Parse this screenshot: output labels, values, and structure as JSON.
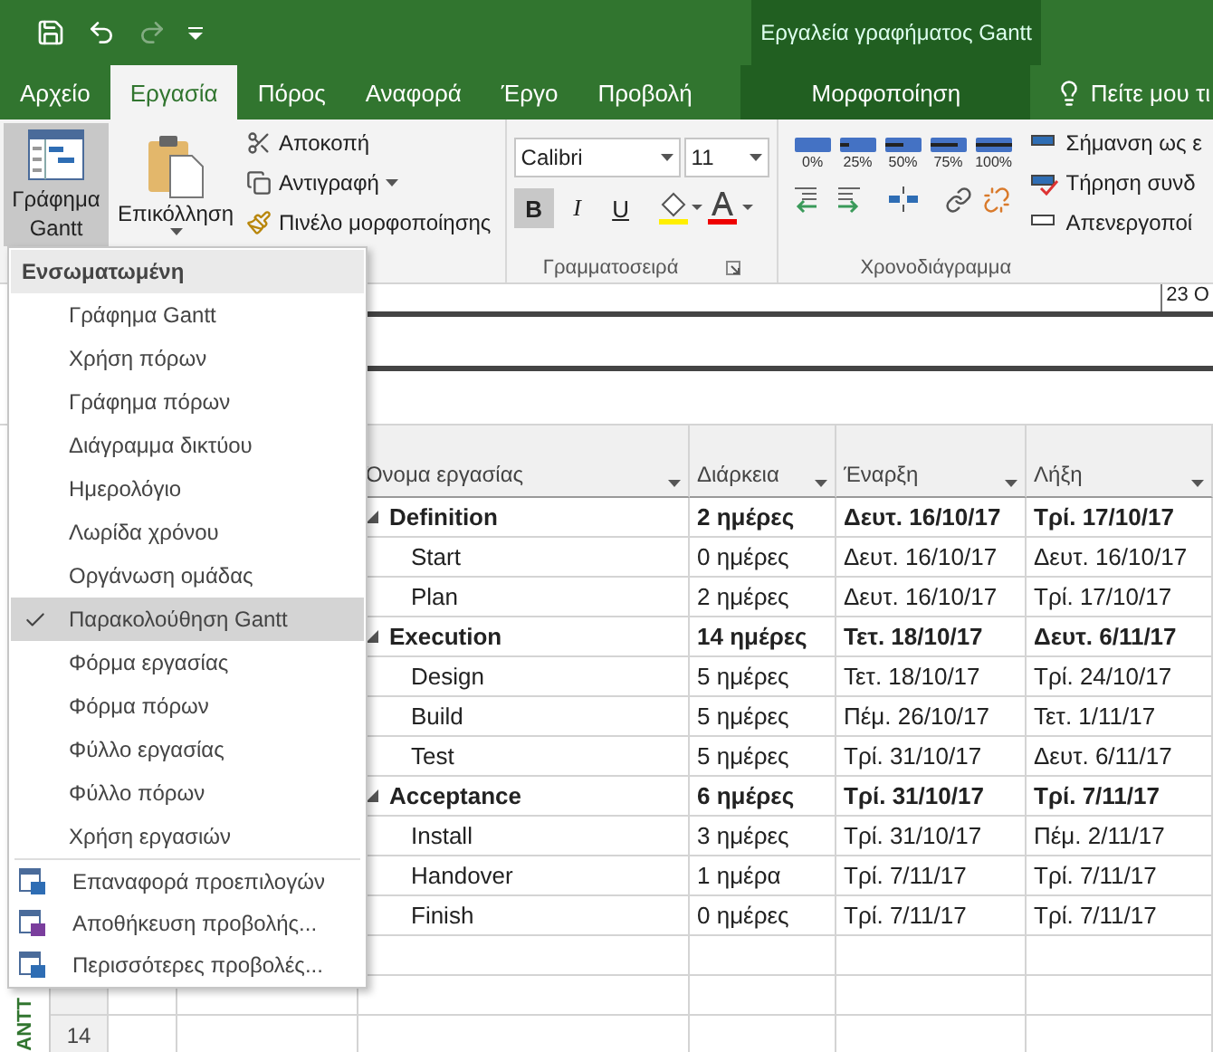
{
  "title_bar": {
    "context_title": "Εργαλεία γραφήματος Gantt",
    "redo_disabled": true
  },
  "tabs": [
    {
      "label": "Αρχείο",
      "selected": false
    },
    {
      "label": "Εργασία",
      "selected": true
    },
    {
      "label": "Πόρος",
      "selected": false
    },
    {
      "label": "Αναφορά",
      "selected": false
    },
    {
      "label": "Έργο",
      "selected": false
    },
    {
      "label": "Προβολή",
      "selected": false
    }
  ],
  "context_tab": {
    "label": "Μορφοποίηση",
    "selected": false
  },
  "tell_me": "Πείτε μου τι",
  "ribbon": {
    "view_button": {
      "label": "Γράφημα Gantt",
      "pressed": true
    },
    "paste": "Επικόλληση",
    "clipboard": [
      "Αποκοπή",
      "Αντιγραφή",
      "Πινέλο μορφοποίησης"
    ],
    "font": {
      "name": "Calibri",
      "size": "11",
      "format": [
        {
          "label": "B",
          "kind": "bold",
          "on": true
        },
        {
          "label": "I",
          "kind": "italic",
          "on": false
        },
        {
          "label": "U",
          "kind": "underline",
          "on": false
        }
      ],
      "label": "Γραμματοσειρά"
    },
    "progress": [
      "0%",
      "25%",
      "50%",
      "75%",
      "100%"
    ],
    "schedule_label": "Χρονοδιάγραμμα",
    "tasks_group": [
      "Σήμανση ως ε",
      "Τήρηση συνδ",
      "Απενεργοποί"
    ]
  },
  "timeline": {
    "date": "23 Ο"
  },
  "table": {
    "columns": [
      "Όνομα εργασίας",
      "Διάρκεια",
      "Έναρξη",
      "Λήξη"
    ],
    "rows": [
      {
        "name": "Definition",
        "duration": "2 ημέρες",
        "start": "Δευτ. 16/10/17",
        "finish": "Τρί. 17/10/17",
        "expanded": true,
        "children": [
          {
            "name": "Start",
            "duration": "0 ημέρες",
            "start": "Δευτ. 16/10/17",
            "finish": "Δευτ. 16/10/17"
          },
          {
            "name": "Plan",
            "duration": "2 ημέρες",
            "start": "Δευτ. 16/10/17",
            "finish": "Τρί. 17/10/17"
          }
        ]
      },
      {
        "name": "Execution",
        "duration": "14 ημέρες",
        "start": "Τετ. 18/10/17",
        "finish": "Δευτ. 6/11/17",
        "expanded": true,
        "children": [
          {
            "name": "Design",
            "duration": "5 ημέρες",
            "start": "Τετ. 18/10/17",
            "finish": "Τρί. 24/10/17"
          },
          {
            "name": "Build",
            "duration": "5 ημέρες",
            "start": "Πέμ. 26/10/17",
            "finish": "Τετ. 1/11/17"
          },
          {
            "name": "Test",
            "duration": "5 ημέρες",
            "start": "Τρί. 31/10/17",
            "finish": "Δευτ. 6/11/17"
          }
        ]
      },
      {
        "name": "Acceptance",
        "duration": "6 ημέρες",
        "start": "Τρί. 31/10/17",
        "finish": "Τρί. 7/11/17",
        "expanded": true,
        "children": [
          {
            "name": "Install",
            "duration": "3 ημέρες",
            "start": "Τρί. 31/10/17",
            "finish": "Πέμ. 2/11/17"
          },
          {
            "name": "Handover",
            "duration": "1 ημέρα",
            "start": "Τρί. 7/11/17",
            "finish": "Τρί. 7/11/17"
          },
          {
            "name": "Finish",
            "duration": "0 ημέρες",
            "start": "Τρί. 7/11/17",
            "finish": "Τρί. 7/11/17"
          }
        ]
      }
    ],
    "last_row_number": "14"
  },
  "side_label": "ANTT",
  "menu": {
    "header": "Ενσωματωμένη",
    "views": [
      {
        "label": "Γράφημα Gantt",
        "selected": false
      },
      {
        "label": "Χρήση πόρων",
        "selected": false
      },
      {
        "label": "Γράφημα πόρων",
        "selected": false
      },
      {
        "label": "Διάγραμμα δικτύου",
        "selected": false
      },
      {
        "label": "Ημερολόγιο",
        "selected": false
      },
      {
        "label": "Λωρίδα χρόνου",
        "selected": false
      },
      {
        "label": "Οργάνωση ομάδας",
        "selected": false
      },
      {
        "label": "Παρακολούθηση Gantt",
        "selected": true
      },
      {
        "label": "Φόρμα εργασίας",
        "selected": false
      },
      {
        "label": "Φόρμα πόρων",
        "selected": false
      },
      {
        "label": "Φύλλο εργασίας",
        "selected": false
      },
      {
        "label": "Φύλλο πόρων",
        "selected": false
      },
      {
        "label": "Χρήση εργασιών",
        "selected": false
      }
    ],
    "actions": [
      {
        "label": "Επαναφορά προεπιλογών",
        "kind": "reset"
      },
      {
        "label": "Αποθήκευση προβολής...",
        "kind": "save"
      },
      {
        "label": "Περισσότερες προβολές...",
        "kind": "more"
      }
    ]
  }
}
